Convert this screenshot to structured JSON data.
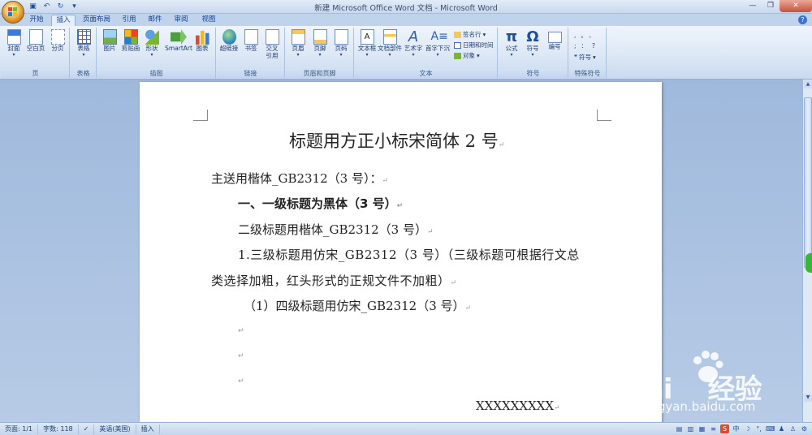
{
  "window": {
    "title": "新建 Microsoft Office Word 文档 - Microsoft Word"
  },
  "tabs": [
    "开始",
    "插入",
    "页面布局",
    "引用",
    "邮件",
    "审阅",
    "视图"
  ],
  "ribbon": {
    "groups": {
      "pages": "页",
      "table": "表格",
      "illustrations": "插图",
      "links": "链接",
      "header_footer": "页眉和页脚",
      "text": "文本",
      "symbols": "符号",
      "special_symbols": "特殊符号"
    },
    "buttons": {
      "cover": "封面",
      "blank_page": "空白页",
      "page_break": "分页",
      "table": "表格",
      "picture": "图片",
      "clip_art": "剪贴画",
      "shapes": "形状",
      "smartart": "SmartArt",
      "chart": "图表",
      "hyperlink": "超链接",
      "bookmark": "书签",
      "cross_ref_line1": "交叉",
      "cross_ref_line2": "引用",
      "header": "页眉",
      "footer": "页脚",
      "page_number": "页码",
      "text_box": "文本框",
      "quick_parts": "文档部件",
      "wordart": "艺术字",
      "drop_cap": "首字下沉",
      "signature_line": "签名行",
      "date_time": "日期和时间",
      "object": "对象",
      "equation": "公式",
      "symbol": "符号",
      "numbering": "编号",
      "special_symbol": "符号"
    }
  },
  "document": {
    "title": "标题用方正小标宋简体 2 号",
    "recipient": "主送用楷体_GB2312（3 号）：",
    "heading1": "一、一级标题为黑体（3 号）",
    "heading2": "二级标题用楷体_GB2312（3 号）",
    "heading3_line1": "1.三级标题用仿宋_GB2312（3 号）（三级标题可根据行文总",
    "heading3_line2": "类选择加粗，红头形式的正规文件不加粗）",
    "heading4": "（1）四级标题用仿宋_GB2312（3 号）",
    "signature": "XXXXXXXXX",
    "paragraph_mark": "↵"
  },
  "statusbar": {
    "page": "页面: 1/1",
    "word_count": "字数: 118",
    "language": "英语(美国)",
    "mode": "插入"
  },
  "watermark": {
    "brand": "Bai",
    "brand2": "经验",
    "url": "jingyan.baidu.com"
  },
  "colors": {
    "ribbon_bg": "#dde8f6",
    "doc_bg": "#a9c1df",
    "accent": "#15428b"
  }
}
